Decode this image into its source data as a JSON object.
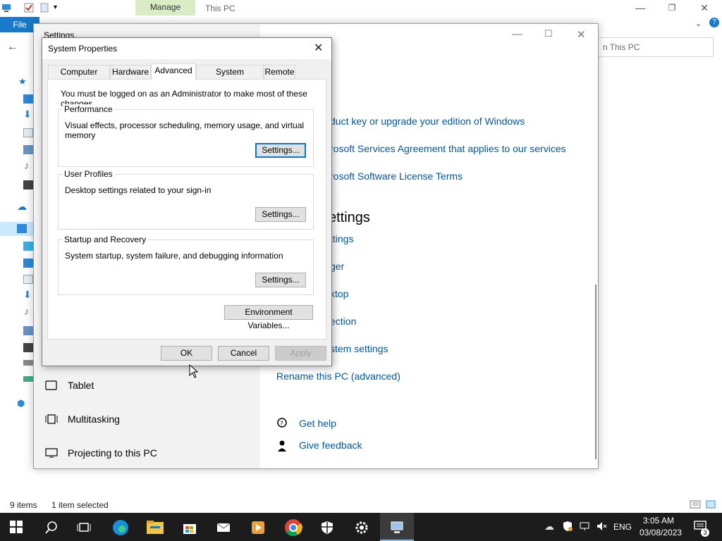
{
  "explorer": {
    "manage_tab": "Manage",
    "title": "This PC",
    "file_tab": "File",
    "search_placeholder": "n This PC",
    "status_items": "9 items",
    "status_selected": "1 item selected",
    "win_minimize": "—",
    "win_restore": "❐",
    "win_close": "✕"
  },
  "settings": {
    "title": "Settings",
    "links_top": [
      "duct key or upgrade your edition of Windows",
      "rosoft Services Agreement that applies to our services",
      "rosoft Software License Terms"
    ],
    "heading": "ettings",
    "links_related": [
      "ttings",
      "ger",
      "ktop",
      "ection",
      "stem settings",
      "Rename this PC (advanced)"
    ],
    "sidebar": [
      "Tablet",
      "Multitasking",
      "Projecting to this PC"
    ],
    "help": "Get help",
    "feedback": "Give feedback"
  },
  "sysprop": {
    "title": "System Properties",
    "tabs": [
      "Computer Name",
      "Hardware",
      "Advanced",
      "System Protection",
      "Remote"
    ],
    "admin_note": "You must be logged on as an Administrator to make most of these changes.",
    "groups": [
      {
        "title": "Performance",
        "desc": "Visual effects, processor scheduling, memory usage, and virtual memory",
        "button": "Settings..."
      },
      {
        "title": "User Profiles",
        "desc": "Desktop settings related to your sign-in",
        "button": "Settings..."
      },
      {
        "title": "Startup and Recovery",
        "desc": "System startup, system failure, and debugging information",
        "button": "Settings..."
      }
    ],
    "env_button": "Environment Variables...",
    "ok": "OK",
    "cancel": "Cancel",
    "apply": "Apply"
  },
  "taskbar": {
    "lang": "ENG",
    "time": "3:05 AM",
    "date": "03/08/2023",
    "notifications": "3"
  },
  "colors": {
    "accent": "#0078d7",
    "link": "#00569c",
    "taskbar": "#1c1c1c",
    "manage_tab": "#d9ecc6"
  }
}
